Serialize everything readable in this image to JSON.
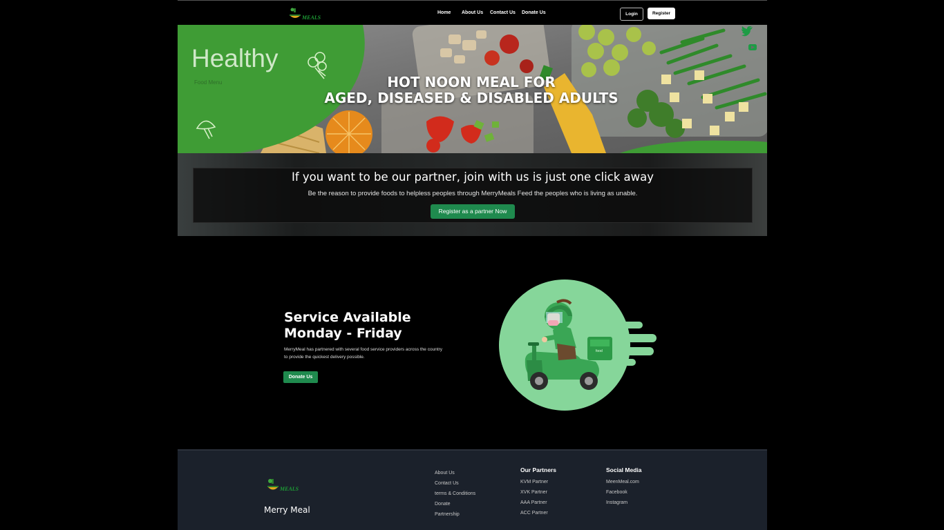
{
  "nav": {
    "logo_text": "MEALS",
    "links": [
      "Home",
      "About Us",
      "Contact Us",
      "Donate Us"
    ],
    "login_label": "Login",
    "register_label": "Register"
  },
  "hero": {
    "badge_title": "Healthy",
    "badge_subtitle": "Food Menu",
    "headline_line1": "HOT NOON MEAL FOR",
    "headline_line2": "AGED, DISEASED & DISABLED ADULTS",
    "social_icons": [
      "twitter-icon",
      "youtube-icon"
    ]
  },
  "partner": {
    "title": "If you want to be our partner, join with us is just one click away",
    "subtitle": "Be the reason to provide foods to helpless peoples through MerryMeals Feed the peoples who is living as unable.",
    "button_label": "Register as a partner Now"
  },
  "service": {
    "title_line1": "Service Available",
    "title_line2": "Monday - Friday",
    "description_line1": "MerryMeal has partnered with several food service providers across the country",
    "description_line2": "to provide the quickest delivery possible.",
    "button_label": "Donate Us",
    "rider_box_label": "food"
  },
  "footer": {
    "logo_text": "MEALS",
    "brand_name": "Merry Meal",
    "links": [
      "About Us",
      "Contact Us",
      "terms & Conditions",
      "Donate",
      "Partnership"
    ],
    "partners_heading": "Our Partners",
    "partners": [
      "KVM Partner",
      "XVK Partner",
      "AAA Partner",
      "ACC Partner"
    ],
    "social_heading": "Social Media",
    "social": [
      "MeenMeal.com",
      "Facebook",
      "Instagram"
    ]
  },
  "colors": {
    "accent_green": "#1f8a4e",
    "hero_green": "#3f9c35",
    "rider_circle": "#86d69a",
    "footer_bg": "#1b212b"
  }
}
